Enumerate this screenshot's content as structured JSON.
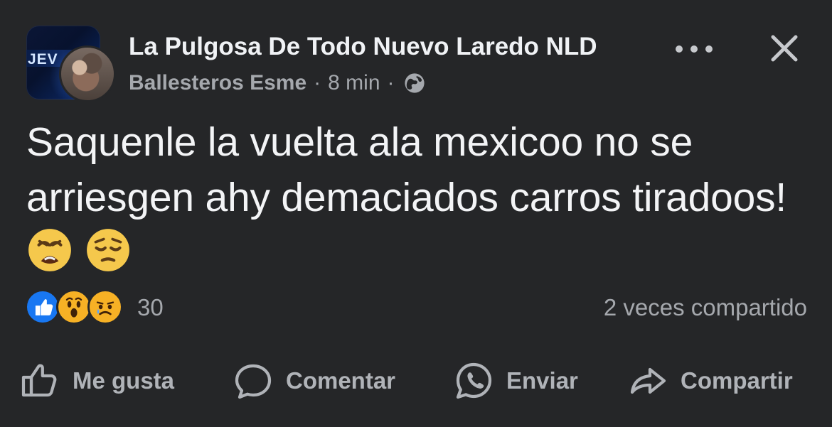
{
  "post": {
    "group_name": "La Pulgosa De Todo Nuevo Laredo NLD",
    "group_avatar_text": "JEV",
    "author": "Ballesteros Esme",
    "separator_1": "·",
    "time": "8 min",
    "separator_2": "·",
    "privacy_icon": "globe-icon",
    "message": "Saquenle la vuelta ala mexicoo no se arriesgen ahy demaciados carros tiradoos!",
    "message_emojis": [
      "weary-face-emoji",
      "pensive-face-emoji"
    ]
  },
  "reactions": {
    "icons": [
      "like-icon",
      "wow-icon",
      "sad-icon"
    ],
    "count": "30",
    "shares": "2 veces compartido"
  },
  "actions": {
    "like": {
      "label": "Me gusta",
      "icon": "thumbs-up-icon"
    },
    "comment": {
      "label": "Comentar",
      "icon": "comment-icon"
    },
    "send": {
      "label": "Enviar",
      "icon": "whatsapp-icon"
    },
    "share": {
      "label": "Compartir",
      "icon": "share-icon"
    }
  },
  "colors": {
    "background": "#252628",
    "primary_text": "#f0f2f5",
    "secondary_text": "#a5a8ad",
    "like_blue": "#1877f2",
    "reaction_yellow": "#f7b125"
  }
}
